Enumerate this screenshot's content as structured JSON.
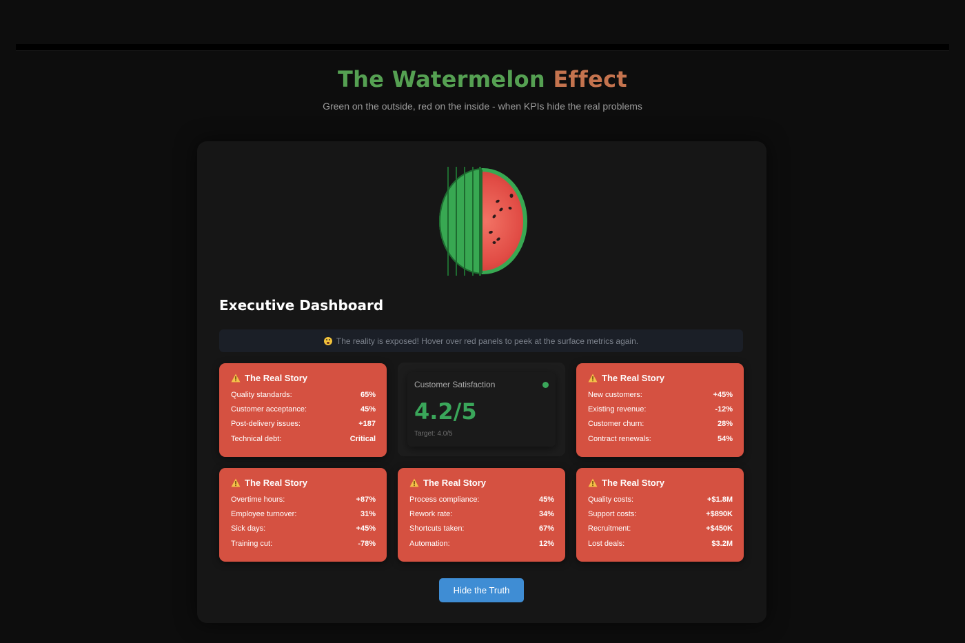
{
  "header": {
    "title_part1": "The Watermelon",
    "title_part2": "Effect",
    "subtitle": "Green on the outside, red on the inside - when KPIs hide the real problems"
  },
  "dashboard": {
    "title": "Executive Dashboard",
    "notice": "The reality is exposed! Hover over red panels to peek at the surface metrics again.",
    "card_heading": "The Real Story",
    "cards": [
      {
        "rows": [
          {
            "label": "Quality standards:",
            "value": "65%"
          },
          {
            "label": "Customer acceptance:",
            "value": "45%"
          },
          {
            "label": "Post-delivery issues:",
            "value": "+187"
          },
          {
            "label": "Technical debt:",
            "value": "Critical"
          }
        ]
      },
      {
        "rows": [
          {
            "label": "New customers:",
            "value": "+45%"
          },
          {
            "label": "Existing revenue:",
            "value": "-12%"
          },
          {
            "label": "Customer churn:",
            "value": "28%"
          },
          {
            "label": "Contract renewals:",
            "value": "54%"
          }
        ]
      },
      {
        "rows": [
          {
            "label": "Overtime hours:",
            "value": "+87%"
          },
          {
            "label": "Employee turnover:",
            "value": "31%"
          },
          {
            "label": "Sick days:",
            "value": "+45%"
          },
          {
            "label": "Training cut:",
            "value": "-78%"
          }
        ]
      },
      {
        "rows": [
          {
            "label": "Process compliance:",
            "value": "45%"
          },
          {
            "label": "Rework rate:",
            "value": "34%"
          },
          {
            "label": "Shortcuts taken:",
            "value": "67%"
          },
          {
            "label": "Automation:",
            "value": "12%"
          }
        ]
      },
      {
        "rows": [
          {
            "label": "Quality costs:",
            "value": "+$1.8M"
          },
          {
            "label": "Support costs:",
            "value": "+$890K"
          },
          {
            "label": "Recruitment:",
            "value": "+$450K"
          },
          {
            "label": "Lost deals:",
            "value": "$3.2M"
          }
        ]
      }
    ],
    "kpi": {
      "label": "Customer Satisfaction",
      "value": "4.2/5",
      "target": "Target: 4.0/5",
      "status_color": "#3aa65a"
    },
    "toggle_button": "Hide the Truth"
  },
  "colors": {
    "red_panel": "#d55141",
    "green": "#3aa65a",
    "button": "#3f8dd4",
    "title_green": "#55a052",
    "title_orange": "#c4734e"
  },
  "icons": {
    "warning": "warning-triangle-icon",
    "notice": "shocked-face-icon",
    "melon": "watermelon-icon"
  }
}
